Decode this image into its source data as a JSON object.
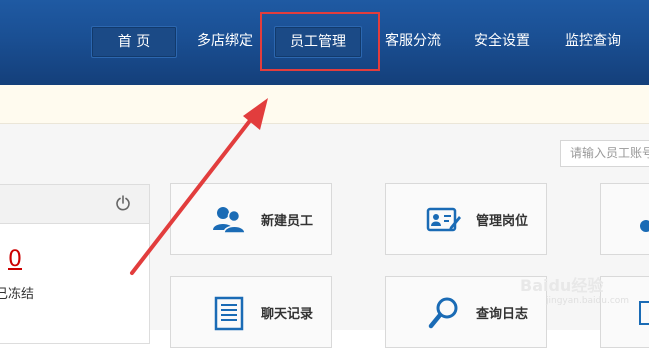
{
  "nav": {
    "items": [
      {
        "label": "首 页"
      },
      {
        "label": "多店绑定"
      },
      {
        "label": "员工管理"
      },
      {
        "label": "客服分流"
      },
      {
        "label": "安全设置"
      },
      {
        "label": "监控查询"
      }
    ],
    "active_index": 0,
    "highlighted_index": 2
  },
  "search": {
    "placeholder": "请输入员工账号"
  },
  "account_panel": {
    "count": "0",
    "count_label": "已冻结"
  },
  "tiles": [
    {
      "label": "新建员工",
      "icon": "users-icon"
    },
    {
      "label": "管理岗位",
      "icon": "id-card-edit-icon"
    },
    {
      "label": "聊天记录",
      "icon": "document-list-icon"
    },
    {
      "label": "查询日志",
      "icon": "magnifier-icon"
    }
  ],
  "watermark": {
    "text": "Baidu经验",
    "sub": "jingyan.baidu.com"
  },
  "colors": {
    "header": "#1a4f93",
    "highlight": "#e23d3d",
    "accent": "#1a6bb5",
    "alert": "#cc0000"
  }
}
